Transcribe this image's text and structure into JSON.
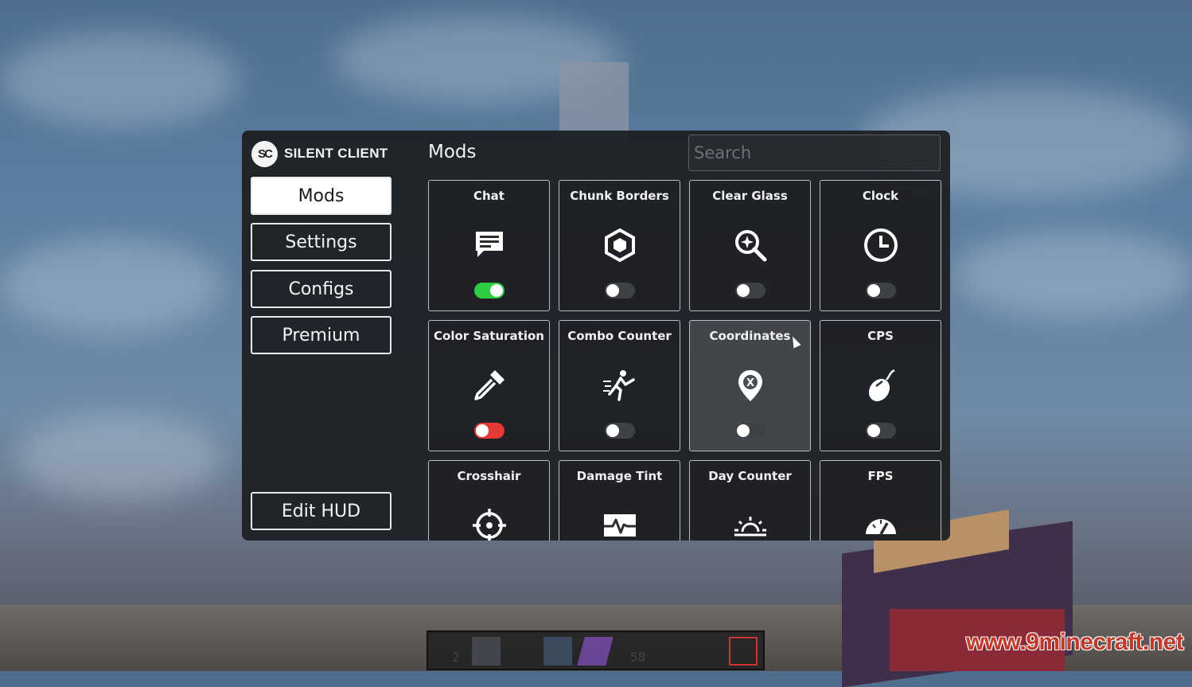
{
  "app": {
    "brand_logo": "SC",
    "brand_name": "SILENT CLIENT"
  },
  "sidebar": {
    "items": [
      {
        "label": "Mods",
        "active": true
      },
      {
        "label": "Settings",
        "active": false
      },
      {
        "label": "Configs",
        "active": false
      },
      {
        "label": "Premium",
        "active": false
      }
    ],
    "edit_hud_label": "Edit HUD"
  },
  "main": {
    "title": "Mods",
    "search_placeholder": "Search",
    "mods": [
      {
        "name": "Chat",
        "icon": "chat-icon",
        "state": "on"
      },
      {
        "name": "Chunk Borders",
        "icon": "hexagon-icon",
        "state": "off"
      },
      {
        "name": "Clear Glass",
        "icon": "magnifier-sparkle-icon",
        "state": "off"
      },
      {
        "name": "Clock",
        "icon": "clock-icon",
        "state": "off"
      },
      {
        "name": "Color Saturation",
        "icon": "eyedropper-icon",
        "state": "disabled"
      },
      {
        "name": "Combo Counter",
        "icon": "running-fighter-icon",
        "state": "off"
      },
      {
        "name": "Coordinates",
        "icon": "map-pin-x-icon",
        "state": "off"
      },
      {
        "name": "CPS",
        "icon": "mouse-icon",
        "state": "off"
      },
      {
        "name": "Crosshair",
        "icon": "crosshair-icon",
        "state": "off"
      },
      {
        "name": "Damage Tint",
        "icon": "heartbeat-icon",
        "state": "off"
      },
      {
        "name": "Day Counter",
        "icon": "sunrise-icon",
        "state": "off"
      },
      {
        "name": "FPS",
        "icon": "speedometer-icon",
        "state": "off"
      }
    ]
  },
  "hotbar": {
    "counts": [
      "2",
      "58"
    ]
  },
  "watermark": "www.9minecraft.net",
  "colors": {
    "toggle_on": "#2ecc40",
    "toggle_disabled": "#e53935",
    "toggle_off": "#3e4146",
    "panel_bg": "#1c1e21"
  }
}
